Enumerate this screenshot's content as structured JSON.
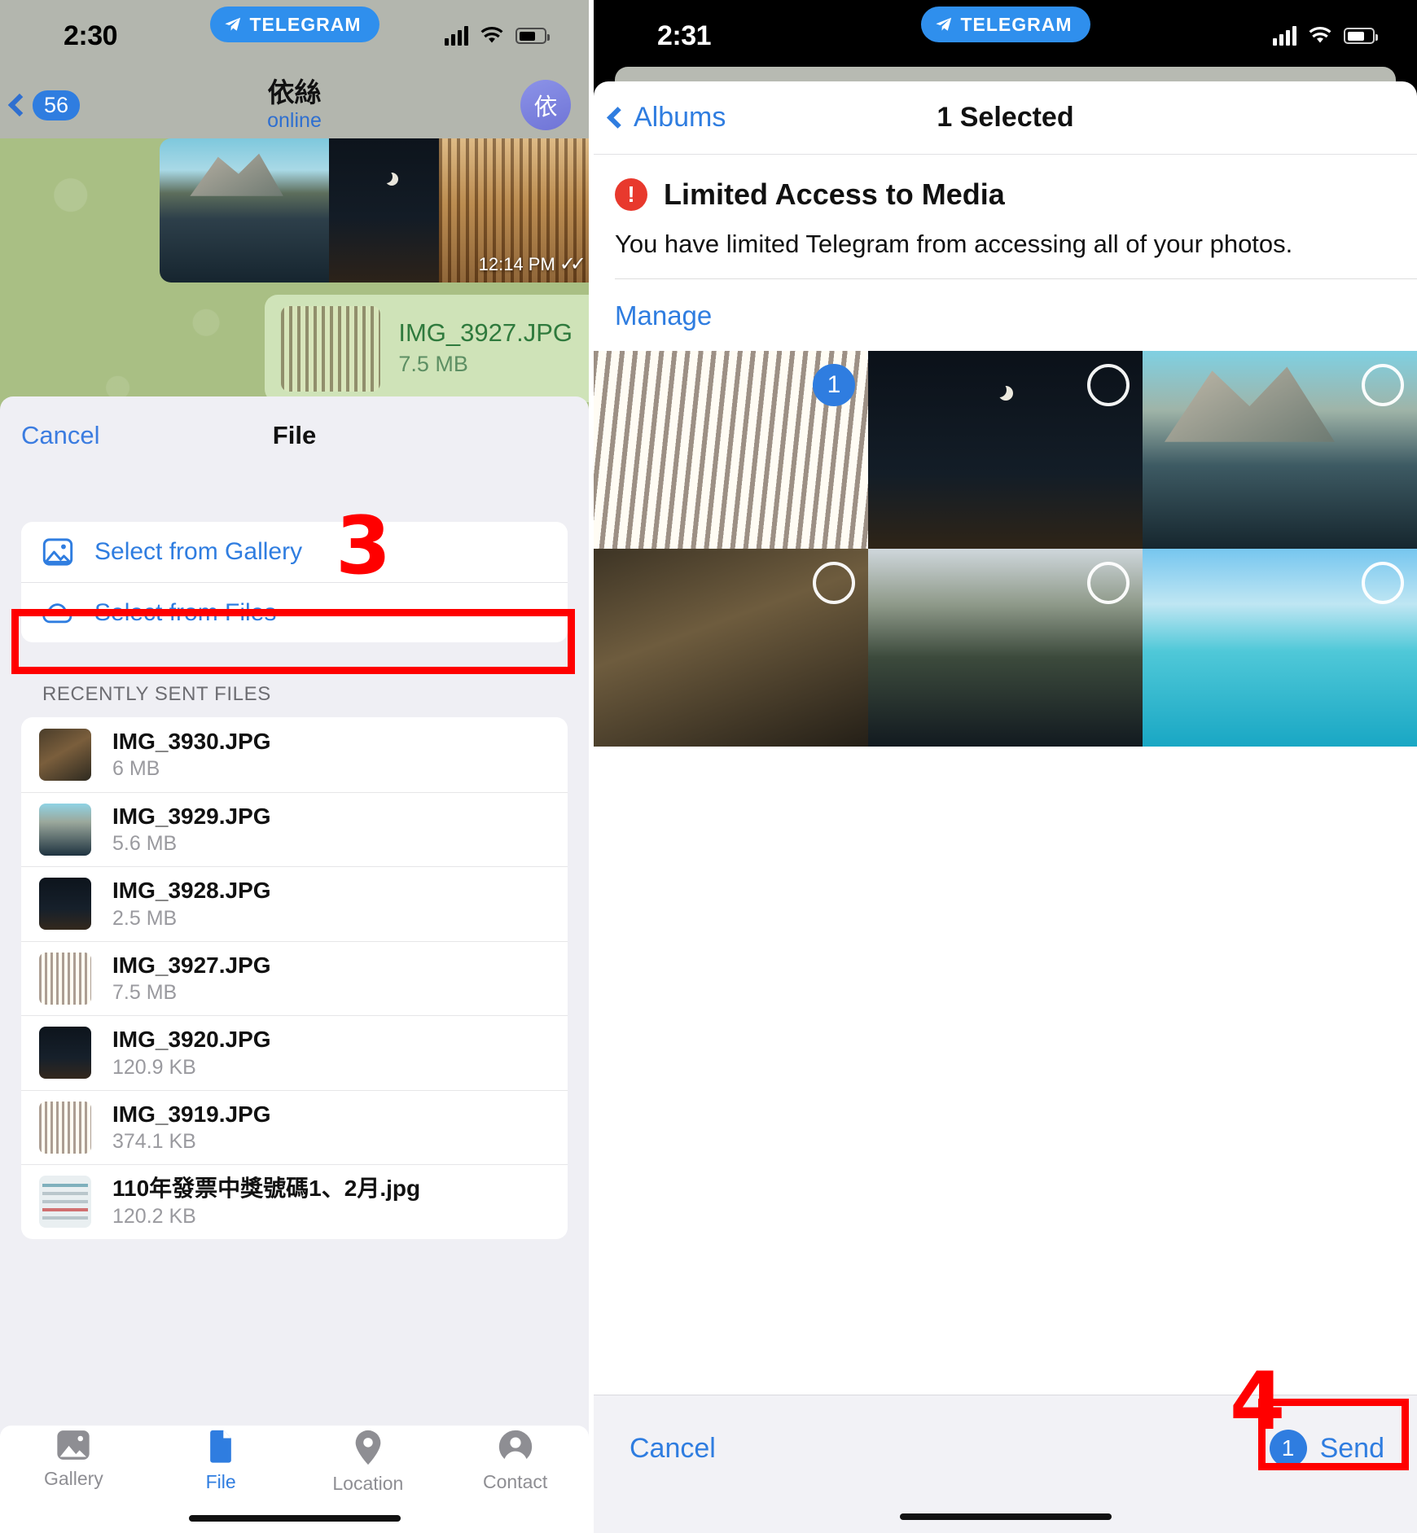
{
  "left_phone": {
    "status_bar": {
      "time": "2:30",
      "app_pill": "TELEGRAM",
      "signal_icon": "cellular-signal-icon",
      "wifi_icon": "wifi-icon",
      "battery_icon": "battery-icon"
    },
    "chat_nav": {
      "back_icon": "chevron-left-icon",
      "back_badge": "56",
      "contact_name": "依絲",
      "contact_status": "online",
      "avatar_initial": "依"
    },
    "chat": {
      "album_time": "12:14 PM",
      "read_ticks": "✓✓",
      "file_message": {
        "name": "IMG_3927.JPG",
        "size": "7.5 MB"
      }
    },
    "sheet": {
      "cancel_label": "Cancel",
      "title": "File",
      "actions": [
        {
          "label": "Select from Gallery",
          "icon": "photo-icon"
        },
        {
          "label": "Select from Files",
          "icon": "cloud-icon"
        }
      ],
      "section_header": "RECENTLY SENT FILES",
      "files": [
        {
          "name": "IMG_3930.JPG",
          "size": "6 MB",
          "thumb": "t-leaves"
        },
        {
          "name": "IMG_3929.JPG",
          "size": "5.6 MB",
          "thumb": "t-lake"
        },
        {
          "name": "IMG_3928.JPG",
          "size": "2.5 MB",
          "thumb": "t-city"
        },
        {
          "name": "IMG_3927.JPG",
          "size": "7.5 MB",
          "thumb": "t-forest"
        },
        {
          "name": "IMG_3920.JPG",
          "size": "120.9 KB",
          "thumb": "t-city"
        },
        {
          "name": "IMG_3919.JPG",
          "size": "374.1 KB",
          "thumb": "t-forest"
        },
        {
          "name": "110年發票中獎號碼1、2月.jpg",
          "size": "120.2 KB",
          "thumb": "t-doc"
        }
      ]
    },
    "tabbar": [
      {
        "label": "Gallery",
        "icon": "gallery-icon",
        "active": false
      },
      {
        "label": "File",
        "icon": "file-icon",
        "active": true
      },
      {
        "label": "Location",
        "icon": "location-pin-icon",
        "active": false
      },
      {
        "label": "Contact",
        "icon": "contact-person-icon",
        "active": false
      }
    ]
  },
  "right_phone": {
    "status_bar": {
      "time": "2:31",
      "app_pill": "TELEGRAM",
      "signal_icon": "cellular-signal-icon",
      "wifi_icon": "wifi-icon",
      "battery_icon": "battery-icon"
    },
    "nav": {
      "back_icon": "chevron-left-icon",
      "back_label": "Albums",
      "title": "1 Selected"
    },
    "limited_access": {
      "alert_icon": "exclamation-circle-icon",
      "title": "Limited Access to Media",
      "body": "You have limited Telegram from accessing all of your photos.",
      "manage_label": "Manage"
    },
    "photo_grid": [
      {
        "thumb": "g-forest-a",
        "selected": true,
        "order": "1"
      },
      {
        "thumb": "g-city",
        "selected": false,
        "order": ""
      },
      {
        "thumb": "g-mtn",
        "selected": false,
        "order": ""
      },
      {
        "thumb": "g-berry",
        "selected": false,
        "order": ""
      },
      {
        "thumb": "g-pine",
        "selected": false,
        "order": ""
      },
      {
        "thumb": "g-beach",
        "selected": false,
        "order": ""
      }
    ],
    "bottom": {
      "cancel_label": "Cancel",
      "send_count": "1",
      "send_label": "Send"
    }
  },
  "annotations": [
    {
      "id": "3",
      "label": "3",
      "target": "select-from-gallery-row"
    },
    {
      "id": "4",
      "label": "4",
      "target": "send-button"
    }
  ],
  "colors": {
    "accent_blue": "#2f7de0",
    "alert_red": "#e8392d",
    "annotation_red": "#ff0000",
    "chat_green": "#a9bf84"
  }
}
